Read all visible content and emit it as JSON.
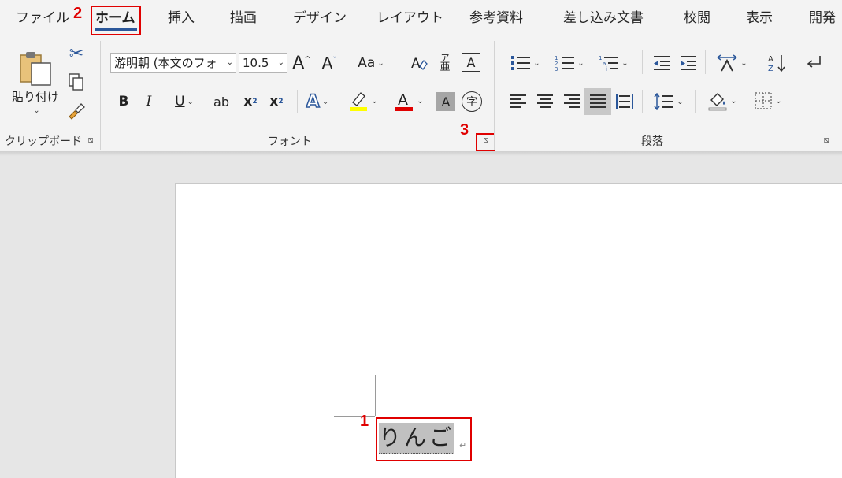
{
  "tabs": [
    {
      "label": "ファイル"
    },
    {
      "label": "ホーム"
    },
    {
      "label": "挿入"
    },
    {
      "label": "描画"
    },
    {
      "label": "デザイン"
    },
    {
      "label": "レイアウト"
    },
    {
      "label": "参考資料"
    },
    {
      "label": "差し込み文書"
    },
    {
      "label": "校閲"
    },
    {
      "label": "表示"
    },
    {
      "label": "開発"
    }
  ],
  "steps": {
    "one": "1",
    "two": "2",
    "three": "3"
  },
  "clipboard": {
    "paste_label": "貼り付け",
    "group_label": "クリップボード"
  },
  "font": {
    "group_label": "フォント",
    "font_name": "游明朝 (本文のフォ",
    "font_size": "10.5",
    "change_case_label": "Aa",
    "bold": "B",
    "italic": "I",
    "underline": "U",
    "strike": "ab",
    "sub": "x",
    "sup": "x",
    "phonetic_top": "ア",
    "phonetic_bottom": "亜",
    "border_char": "A",
    "enclose_char": "字"
  },
  "paragraph": {
    "group_label": "段落"
  },
  "document": {
    "text": "りんご",
    "para_mark": "↵"
  },
  "colors": {
    "accent": "#2b579a",
    "highlight": "#ffff00",
    "font_color": "#e00000",
    "step_red": "#e00000"
  }
}
